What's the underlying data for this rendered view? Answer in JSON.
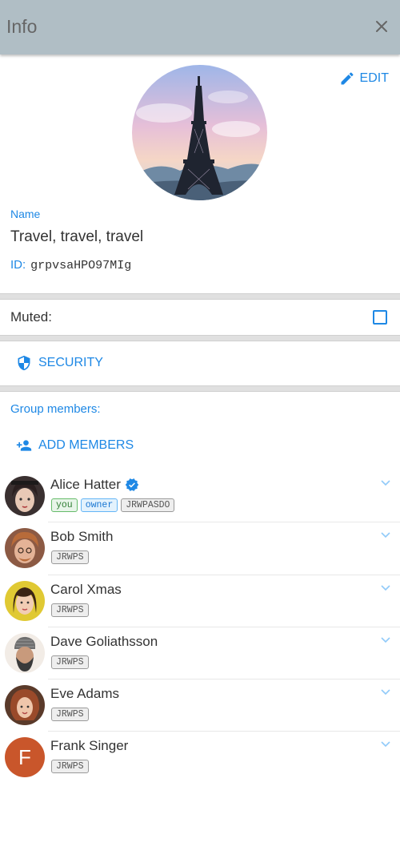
{
  "header": {
    "title": "Info",
    "close_icon": "close-icon"
  },
  "group": {
    "avatar_icon": "eiffel-tower-photo",
    "edit_label": "EDIT",
    "name_label": "Name",
    "name": "Travel, travel, travel",
    "id_label": "ID:",
    "id": "grpvsaHPO97MIg"
  },
  "muted": {
    "label": "Muted:",
    "checked": false
  },
  "security": {
    "label": "SECURITY"
  },
  "members_section": {
    "label": "Group members:",
    "add_label": "ADD MEMBERS",
    "members": [
      {
        "name": "Alice Hatter",
        "verified": true,
        "badges": [
          "you",
          "owner",
          "JRWPASDO"
        ]
      },
      {
        "name": "Bob Smith",
        "badges": [
          "JRWPS"
        ]
      },
      {
        "name": "Carol Xmas",
        "badges": [
          "JRWPS"
        ]
      },
      {
        "name": "Dave Goliathsson",
        "badges": [
          "JRWPS"
        ]
      },
      {
        "name": "Eve Adams",
        "badges": [
          "JRWPS"
        ]
      },
      {
        "name": "Frank Singer",
        "initial": "F",
        "badges": [
          "JRWPS"
        ]
      }
    ]
  },
  "colors": {
    "accent": "#1e88e5",
    "header_bg": "#b0bec5",
    "letter_avatar": "#c9562b"
  }
}
